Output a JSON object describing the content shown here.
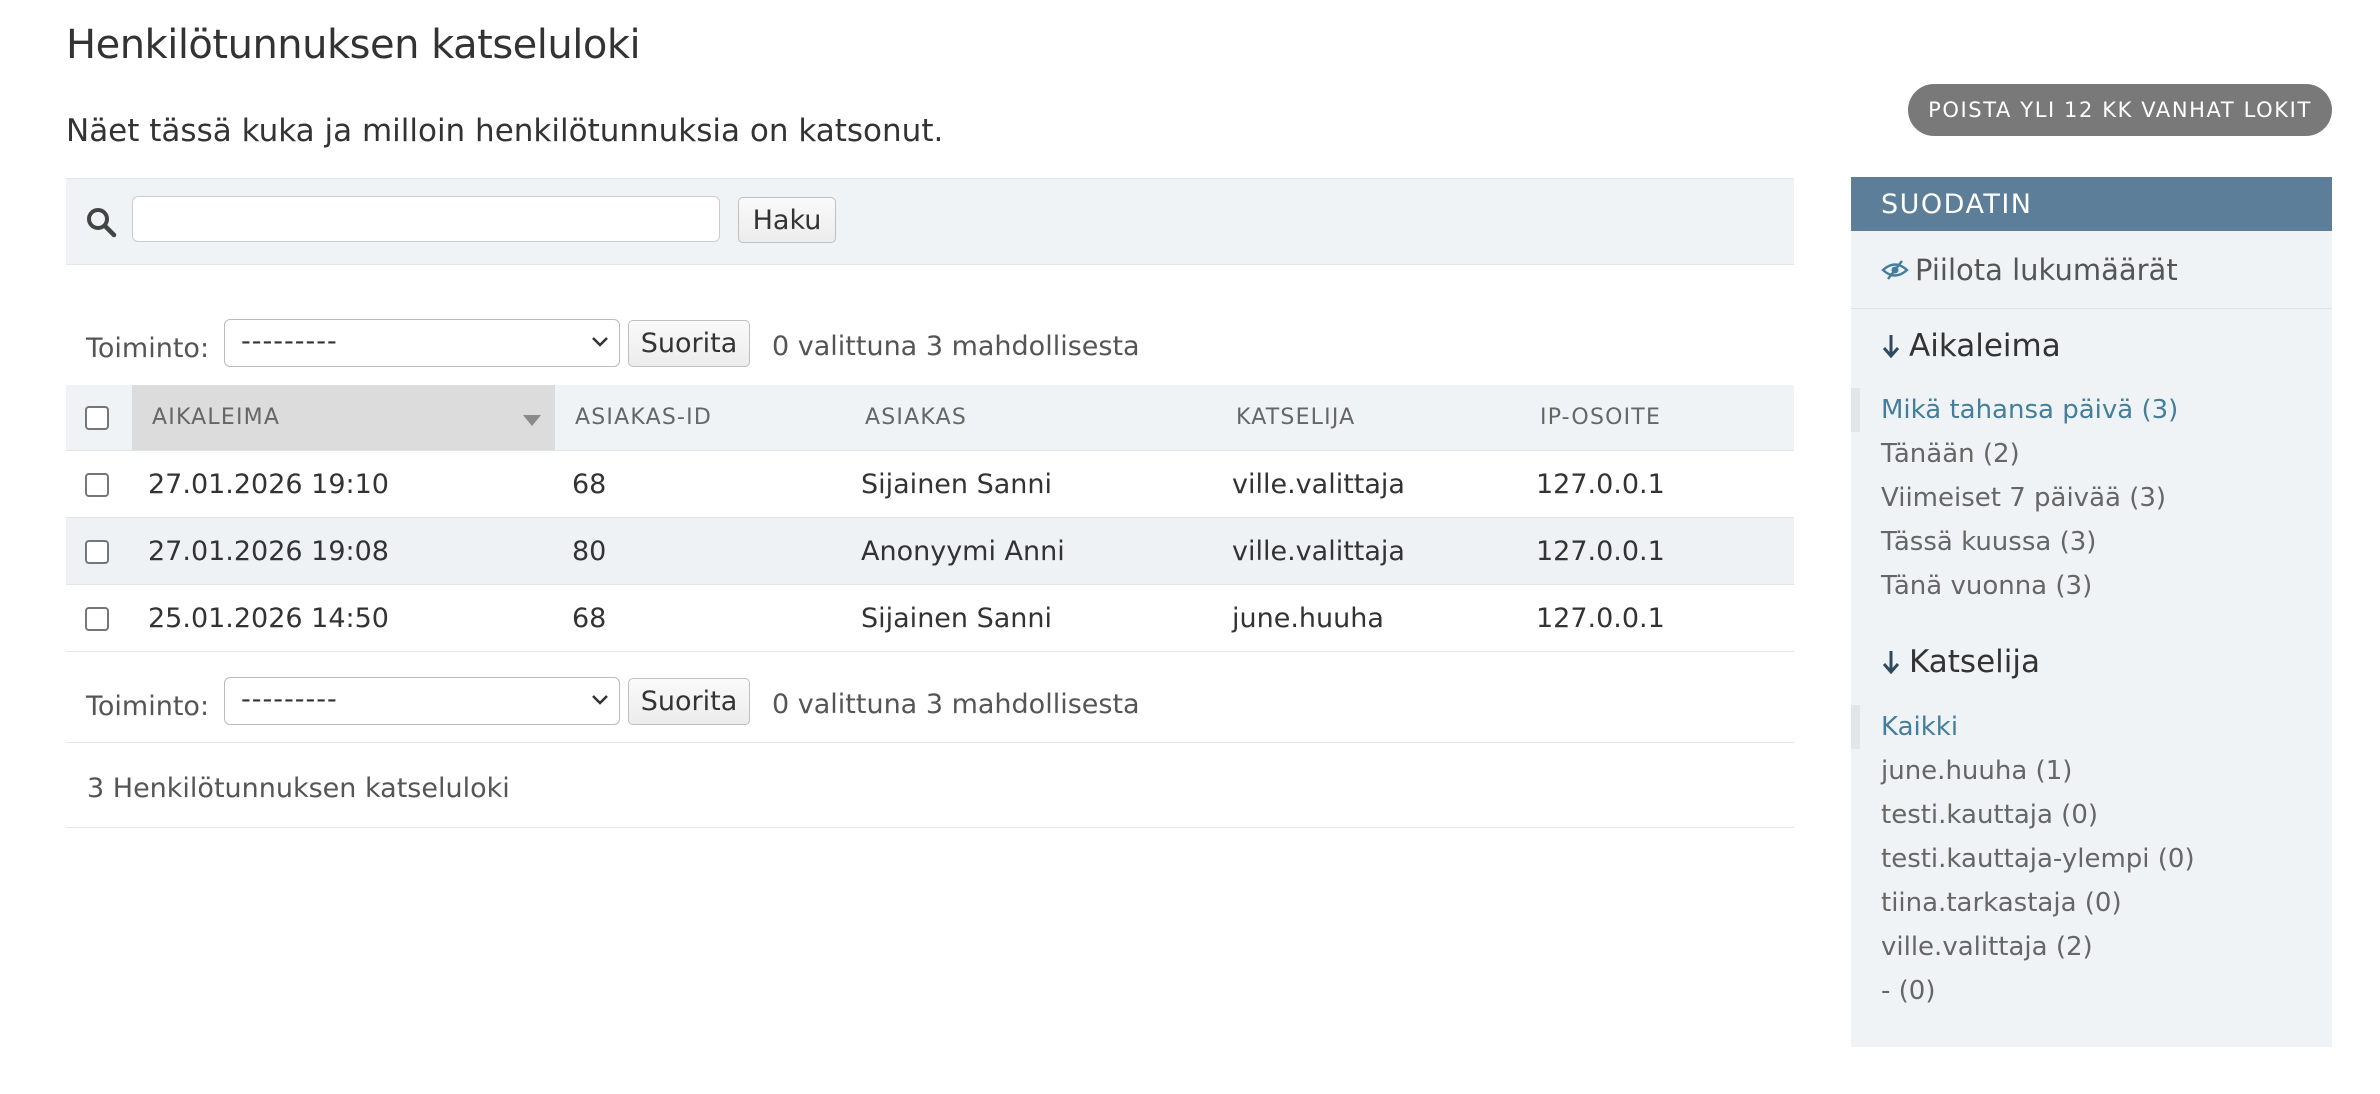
{
  "page": {
    "title": "Henkilötunnuksen katseluloki",
    "subtitle": "Näet tässä kuka ja milloin henkilötunnuksia on katsonut.",
    "delete_button": "POISTA YLI 12 KK VANHAT LOKIT"
  },
  "search": {
    "value": "",
    "button": "Haku",
    "icon": "search-icon"
  },
  "actions": {
    "label": "Toiminto:",
    "select_value": "---------",
    "run_button": "Suorita",
    "counter": "0 valittuna 3 mahdollisesta"
  },
  "table": {
    "headers": [
      "AIKALEIMA",
      "ASIAKAS-ID",
      "ASIAKAS",
      "KATSELIJA",
      "IP-OSOITE"
    ],
    "rows": [
      [
        "27.01.2026 19:10",
        "68",
        "Sijainen Sanni",
        "ville.valittaja",
        "127.0.0.1"
      ],
      [
        "27.01.2026 19:08",
        "80",
        "Anonyymi Anni",
        "ville.valittaja",
        "127.0.0.1"
      ],
      [
        "25.01.2026 14:50",
        "68",
        "Sijainen Sanni",
        "june.huuha",
        "127.0.0.1"
      ]
    ]
  },
  "total": "3 Henkilötunnuksen katseluloki",
  "filter": {
    "header": "SUODATIN",
    "hide_counts": "Piilota lukumäärät",
    "groups": [
      {
        "title": "Aikaleima",
        "items": [
          "Mikä tahansa päivä (3)",
          "Tänään (2)",
          "Viimeiset 7 päivää (3)",
          "Tässä kuussa (3)",
          "Tänä vuonna (3)"
        ],
        "selected": "Mikä tahansa päivä (3)"
      },
      {
        "title": "Katselija",
        "items": [
          "Kaikki",
          "june.huuha (1)",
          "testi.kauttaja (0)",
          "testi.kauttaja-ylempi (0)",
          "tiina.tarkastaja (0)",
          "ville.valittaja (2)",
          "- (0)"
        ],
        "selected": "Kaikki"
      }
    ]
  },
  "colors": {
    "filter_header": "#5d7e99",
    "link": "#447e9b",
    "pill_button": "#797979"
  }
}
